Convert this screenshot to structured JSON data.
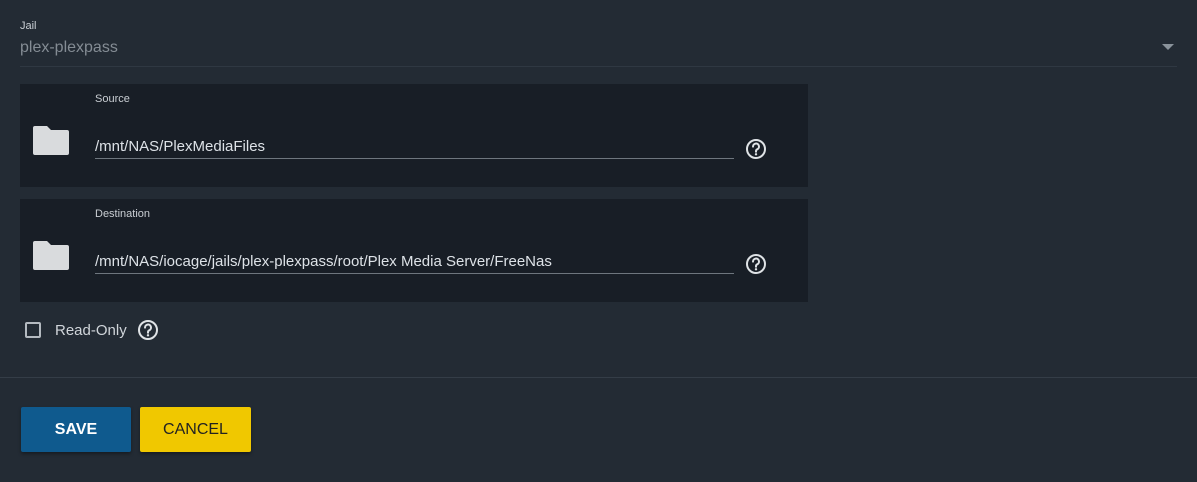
{
  "jail": {
    "label": "Jail",
    "value": "plex-plexpass"
  },
  "source": {
    "label": "Source",
    "value": "/mnt/NAS/PlexMediaFiles",
    "icon": "folder-icon"
  },
  "destination": {
    "label": "Destination",
    "value": "/mnt/NAS/iocage/jails/plex-plexpass/root/Plex Media Server/FreeNas",
    "icon": "folder-icon"
  },
  "read_only": {
    "label": "Read-Only",
    "checked": false
  },
  "actions": {
    "save_label": "SAVE",
    "cancel_label": "CANCEL"
  },
  "colors": {
    "background": "#232b34",
    "panel": "#181e26",
    "save": "#0f5a8e",
    "cancel": "#f0c800"
  }
}
